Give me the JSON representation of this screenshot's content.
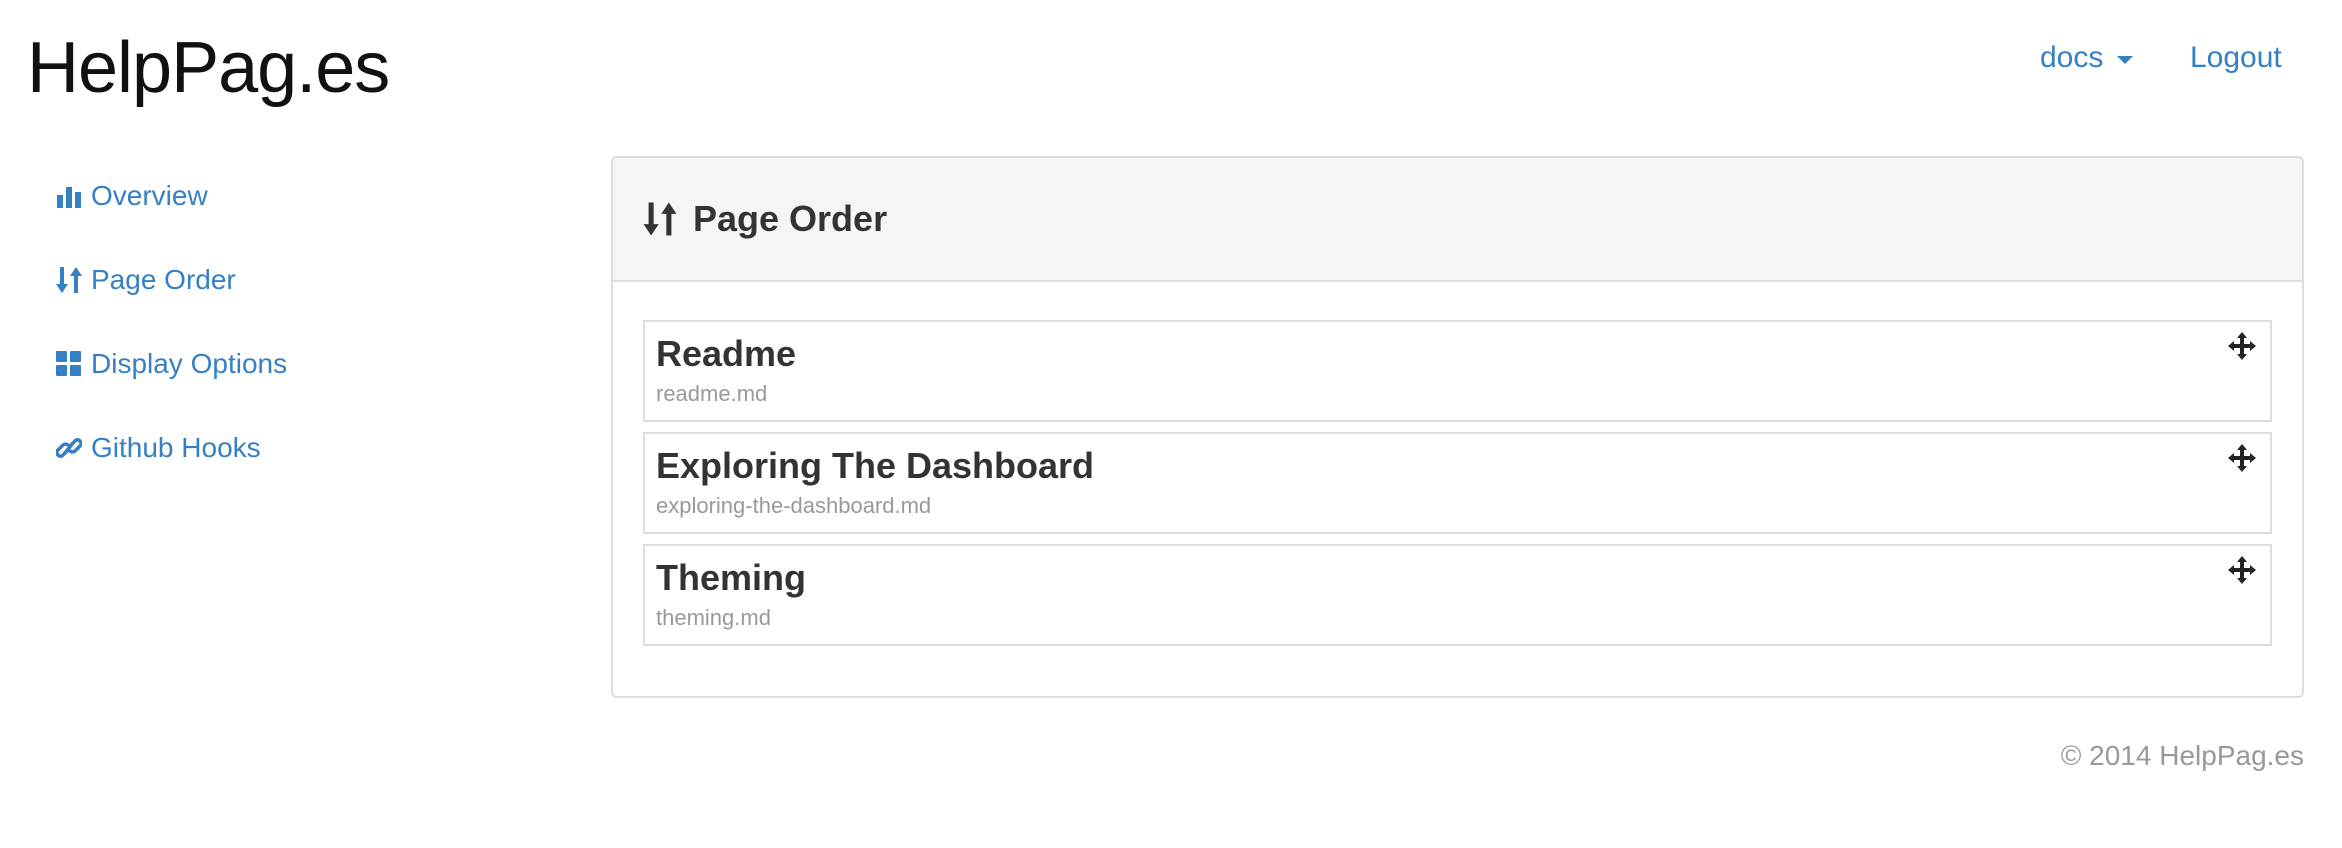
{
  "brand": "HelpPag.es",
  "nav": {
    "docs_label": "docs",
    "logout_label": "Logout"
  },
  "sidebar": {
    "items": [
      {
        "label": "Overview",
        "icon": "bar-chart-icon"
      },
      {
        "label": "Page Order",
        "icon": "sort-icon"
      },
      {
        "label": "Display Options",
        "icon": "grid-icon"
      },
      {
        "label": "Github Hooks",
        "icon": "link-icon"
      }
    ]
  },
  "panel": {
    "title": "Page Order",
    "icon": "sort-icon",
    "pages": [
      {
        "title": "Readme",
        "file": "readme.md"
      },
      {
        "title": "Exploring The Dashboard",
        "file": "exploring-the-dashboard.md"
      },
      {
        "title": "Theming",
        "file": "theming.md"
      }
    ]
  },
  "footer": "© 2014 HelpPag.es",
  "colors": {
    "link": "#3580c4",
    "panel_header_bg": "#f5f5f5",
    "border": "#dddddd",
    "muted": "#999999"
  }
}
